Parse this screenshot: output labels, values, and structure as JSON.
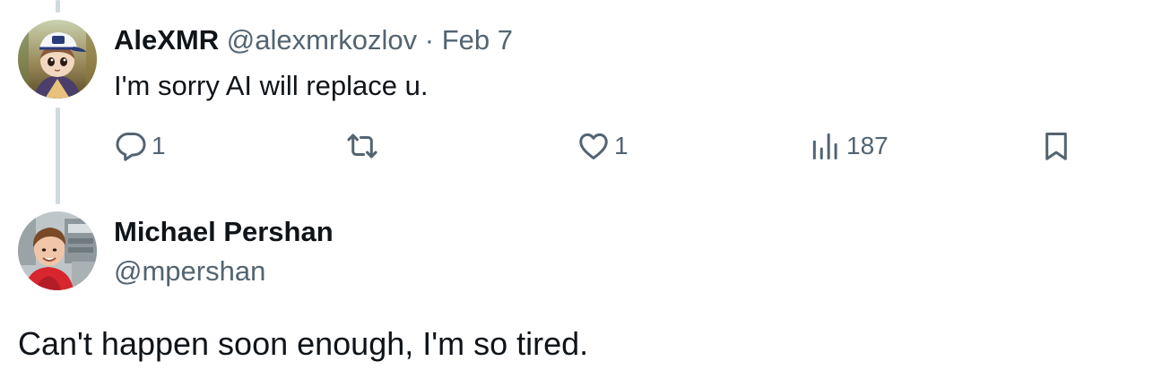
{
  "parent_tweet": {
    "display_name": "AleXMR",
    "handle": "@alexmrkozlov",
    "separator": "·",
    "date": "Feb 7",
    "text": "I'm sorry AI will replace u.",
    "actions": {
      "reply": {
        "icon": "reply-icon",
        "count": "1"
      },
      "retweet": {
        "icon": "retweet-icon",
        "count": ""
      },
      "like": {
        "icon": "heart-icon",
        "count": "1"
      },
      "views": {
        "icon": "views-icon",
        "count": "187"
      },
      "bookmark": {
        "icon": "bookmark-icon"
      }
    }
  },
  "reply_tweet": {
    "display_name": "Michael Pershan",
    "handle": "@mpershan",
    "text": "Can't happen soon enough, I'm so tired."
  },
  "colors": {
    "text_primary": "#0f1419",
    "text_secondary": "#536471",
    "thread_line": "#cfd9de",
    "background": "#ffffff"
  }
}
